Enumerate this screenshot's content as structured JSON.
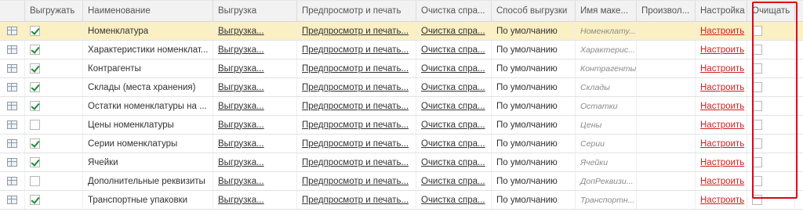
{
  "header": {
    "c1": "Выгружать",
    "c2": "Наименование",
    "c3": "Выгрузка",
    "c4": "Предпросмотр и печать",
    "c5": "Очистка спра...",
    "c6": "Способ выгрузки",
    "c7": "Имя маке...",
    "c8": "Произвол...",
    "c9": "Настройка",
    "c10": "Очищать"
  },
  "rows": [
    {
      "export": true,
      "name": "Номенклатура",
      "unload": "Выгрузка...",
      "preview": "Предпросмотр и печать...",
      "cleanup": "Очистка спра...",
      "method": "По умолчанию",
      "layout": "Номенклату...",
      "custom": "",
      "settings": "Настроить",
      "clear": false,
      "selected": true
    },
    {
      "export": true,
      "name": "Характеристики номенклат...",
      "unload": "Выгрузка...",
      "preview": "Предпросмотр и печать...",
      "cleanup": "Очистка спра...",
      "method": "По умолчанию",
      "layout": "Характерис...",
      "custom": "",
      "settings": "Настроить",
      "clear": false,
      "selected": false
    },
    {
      "export": true,
      "name": "Контрагенты",
      "unload": "Выгрузка...",
      "preview": "Предпросмотр и печать...",
      "cleanup": "Очистка спра...",
      "method": "По умолчанию",
      "layout": "Контрагенты",
      "custom": "",
      "settings": "Настроить",
      "clear": false,
      "selected": false
    },
    {
      "export": true,
      "name": "Склады (места хранения)",
      "unload": "Выгрузка...",
      "preview": "Предпросмотр и печать...",
      "cleanup": "Очистка спра...",
      "method": "По умолчанию",
      "layout": "Склады",
      "custom": "",
      "settings": "Настроить",
      "clear": false,
      "selected": false
    },
    {
      "export": true,
      "name": "Остатки номенклатуры на ...",
      "unload": "Выгрузка...",
      "preview": "Предпросмотр и печать...",
      "cleanup": "Очистка спра...",
      "method": "По умолчанию",
      "layout": "Остатки",
      "custom": "",
      "settings": "Настроить",
      "clear": false,
      "selected": false
    },
    {
      "export": false,
      "name": "Цены номенклатуры",
      "unload": "Выгрузка...",
      "preview": "Предпросмотр и печать...",
      "cleanup": "Очистка спра...",
      "method": "По умолчанию",
      "layout": "Цены",
      "custom": "",
      "settings": "Настроить",
      "clear": false,
      "selected": false
    },
    {
      "export": true,
      "name": "Серии номенклатуры",
      "unload": "Выгрузка...",
      "preview": "Предпросмотр и печать...",
      "cleanup": "Очистка спра...",
      "method": "По умолчанию",
      "layout": "Серии",
      "custom": "",
      "settings": "Настроить",
      "clear": false,
      "selected": false
    },
    {
      "export": true,
      "name": "Ячейки",
      "unload": "Выгрузка...",
      "preview": "Предпросмотр и печать...",
      "cleanup": "Очистка спра...",
      "method": "По умолчанию",
      "layout": "Ячейки",
      "custom": "",
      "settings": "Настроить",
      "clear": false,
      "selected": false
    },
    {
      "export": false,
      "name": "Дополнительные реквизиты",
      "unload": "Выгрузка...",
      "preview": "Предпросмотр и печать...",
      "cleanup": "Очистка спра...",
      "method": "По умолчанию",
      "layout": "ДопРеквизи...",
      "custom": "",
      "settings": "Настроить",
      "clear": false,
      "selected": false
    },
    {
      "export": true,
      "name": "Транспортные упаковки",
      "unload": "Выгрузка...",
      "preview": "Предпросмотр и печать...",
      "cleanup": "Очистка спра...",
      "method": "По умолчанию",
      "layout": "Транспортн...",
      "custom": "",
      "settings": "Настроить",
      "clear": false,
      "selected": false
    }
  ],
  "colors": {
    "highlight": "#e2001a",
    "selected_row": "#fbf0c4",
    "check": "#1e8a33",
    "link_red": "#d11f1f"
  },
  "icons": {
    "row": "table-row-icon",
    "checked": "checkmark-icon"
  }
}
